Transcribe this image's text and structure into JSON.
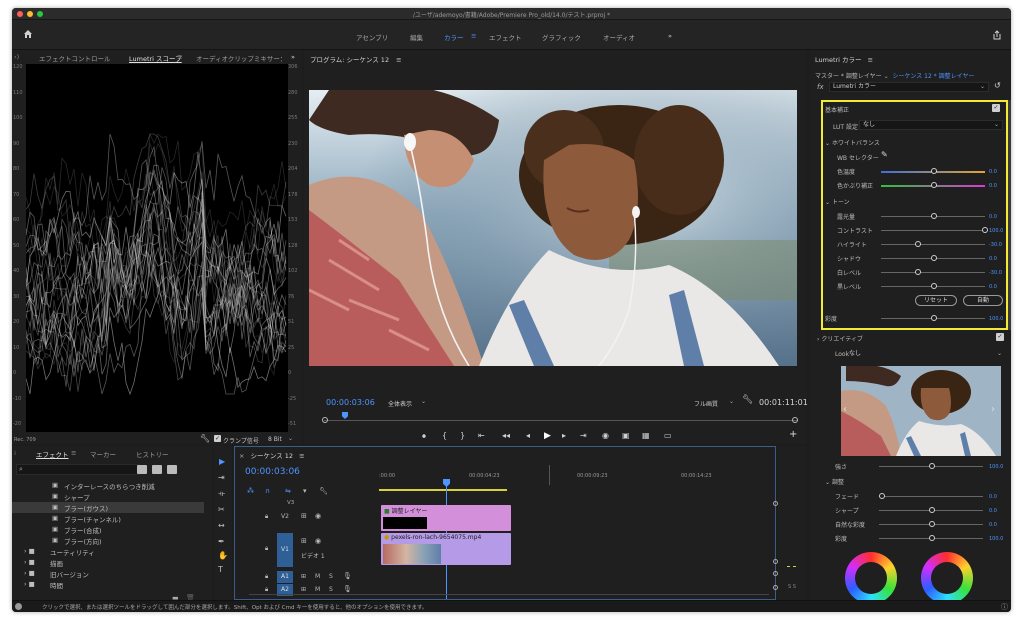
{
  "window": {
    "title": "/ユーザ/ademoyo/書籍/Adobe/Premiere Pro_old/14.0/テスト.prproj *"
  },
  "workspaces": {
    "items": [
      "アセンブリ",
      "編集",
      "カラー",
      "エフェクト",
      "グラフィック",
      "オーディオ"
    ],
    "active": "カラー",
    "more": "»"
  },
  "scope_panel": {
    "tabs": [
      "エフェクトコントロール",
      "Lumetri スコープ",
      "オーディオクリップミキサー：",
      "»"
    ],
    "active_tab": "Lumetri スコープ",
    "left_ticks": [
      "120",
      "110",
      "100",
      "90",
      "80",
      "70",
      "60",
      "50",
      "40",
      "30",
      "20",
      "10",
      "0",
      "-10",
      "-20"
    ],
    "right_ticks": [
      "306",
      "280",
      "255",
      "230",
      "204",
      "178",
      "153",
      "128",
      "102",
      "76",
      "51",
      "25",
      "0",
      "-25",
      "-51"
    ],
    "footer_left": "Rec. 709",
    "clamp_label": "クランプ信号",
    "bit_label": "8 Bit"
  },
  "program": {
    "title": "プログラム: シーケンス 12",
    "timecode": "00:00:03:06",
    "fit": "全体表示",
    "quality": "フル画質",
    "duration": "00:01:11:01"
  },
  "effects_panel": {
    "tabs": [
      "エフェクト",
      "マーカー",
      "ヒストリー"
    ],
    "items": [
      {
        "label": "インターレースのちらつき削減",
        "type": "effect",
        "selected": false
      },
      {
        "label": "シャープ",
        "type": "effect",
        "selected": false
      },
      {
        "label": "ブラー(ガウス)",
        "type": "effect",
        "selected": true
      },
      {
        "label": "ブラー(チャンネル)",
        "type": "effect",
        "selected": false
      },
      {
        "label": "ブラー(合成)",
        "type": "effect",
        "selected": false
      },
      {
        "label": "ブラー(方向)",
        "type": "effect",
        "selected": false
      },
      {
        "label": "ユーティリティ",
        "type": "folder",
        "selected": false
      },
      {
        "label": "描画",
        "type": "folder",
        "selected": false
      },
      {
        "label": "旧バージョン",
        "type": "folder",
        "selected": false
      },
      {
        "label": "時間",
        "type": "folder",
        "selected": false
      }
    ]
  },
  "timeline": {
    "title": "シーケンス 12",
    "timecode": "00:00:03:06",
    "ruler": [
      ":00:00",
      "00:00:04:23",
      "00:00:09:23",
      "00:00:14:23"
    ],
    "tracks": [
      {
        "name": "V2",
        "label": ""
      },
      {
        "name": "V1",
        "label": "ビデオ 1"
      },
      {
        "name": "A1",
        "label": ""
      },
      {
        "name": "A2",
        "label": ""
      }
    ],
    "adjust_clip": "調整レイヤー",
    "video_clip": "pexels-ron-lach-9654075.mp4",
    "audio_flags": [
      "M",
      "S"
    ],
    "v3": "V3"
  },
  "lumetri": {
    "title": "Lumetri カラー",
    "master": "マスター * 調整レイヤー",
    "sequence": "シーケンス 12 * 調整レイヤー",
    "fx": "fx",
    "effect_name": "Lumetri カラー",
    "basic": {
      "title": "基本補正",
      "lut_label": "LUT 設定",
      "lut_value": "なし",
      "wb_title": "ホワイトバランス",
      "wb_selector": "WB セレクター",
      "temp": {
        "label": "色温度",
        "value": "0.0"
      },
      "tint": {
        "label": "色かぶり補正",
        "value": "0.0"
      },
      "tone_title": "トーン",
      "exposure": {
        "label": "露光量",
        "value": "0.0"
      },
      "contrast": {
        "label": "コントラスト",
        "value": "100.0"
      },
      "highlight": {
        "label": "ハイライト",
        "value": "-30.0"
      },
      "shadow": {
        "label": "シャドウ",
        "value": "0.0"
      },
      "white": {
        "label": "白レベル",
        "value": "-30.0"
      },
      "black": {
        "label": "黒レベル",
        "value": "0.0"
      },
      "reset": "リセット",
      "auto": "自動",
      "saturation": {
        "label": "彩度",
        "value": "100.0"
      }
    },
    "creative": {
      "title": "クリエイティブ",
      "look_label": "Look",
      "look_value": "なし",
      "intensity": {
        "label": "強さ",
        "value": "100.0"
      },
      "adjust_title": "調整",
      "fade": {
        "label": "フェード",
        "value": "0.0"
      },
      "sharp": {
        "label": "シャープ",
        "value": "0.0"
      },
      "vibrance": {
        "label": "自然な彩度",
        "value": "0.0"
      },
      "saturation": {
        "label": "彩度",
        "value": "100.0"
      }
    }
  },
  "status_bar": {
    "text": "クリックで選択、または選択ツールをドラッグして囲んだ部分を選択します。Shift、Opt および Cmd キーを使用すると、他のオプションを使用できます。"
  },
  "colors": {
    "accent": "#4e95ff",
    "highlight_box": "#f4ea36",
    "adjust_clip": "#d38fd9",
    "video_clip": "#b59ae8"
  }
}
